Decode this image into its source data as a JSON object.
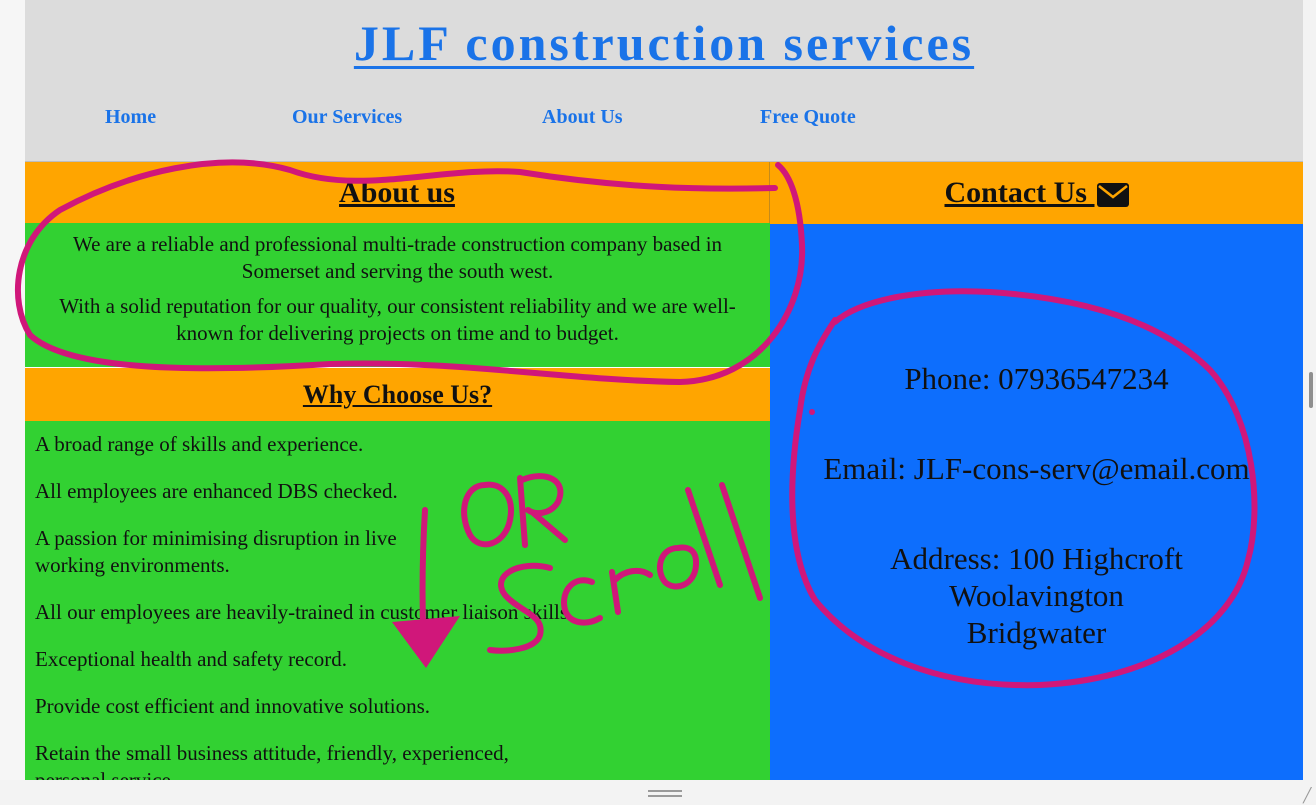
{
  "header": {
    "title": "JLF construction services",
    "nav": [
      "Home",
      "Our Services",
      "About Us",
      "Free Quote"
    ]
  },
  "about": {
    "heading": "About us",
    "paragraphs": [
      "We are a reliable and professional multi-trade construction company based in Somerset and serving the south west.",
      "With a solid reputation for our quality, our consistent reliability and we are well-known for delivering projects on time and to budget."
    ]
  },
  "why": {
    "heading": "Why Choose Us?",
    "items": [
      "A broad range of skills and experience.",
      "All employees are enhanced DBS checked.",
      "A passion for minimising disruption in live working environments.",
      "All our employees are heavily-trained in customer liaison skills.",
      "Exceptional health and safety record.",
      "Provide cost efficient and innovative solutions.",
      "Retain the small business attitude, friendly, experienced, personal service."
    ]
  },
  "contact": {
    "heading": "Contact Us",
    "heading_icon": "envelope-icon",
    "phone": "Phone: 07936547234",
    "email": "Email: JLF-cons-serv@email.com",
    "address_lines": [
      "Address: 100 Highcroft",
      "Woolavington",
      "Bridgwater"
    ]
  },
  "annotation": {
    "handwritten_text": "OR Scroll",
    "color": "#d0177a"
  },
  "colors": {
    "header_bg": "#dcdcdc",
    "link_blue": "#1a73e8",
    "section_orange": "#ffa500",
    "panel_green": "#32d132",
    "contact_blue": "#0d6efd"
  }
}
